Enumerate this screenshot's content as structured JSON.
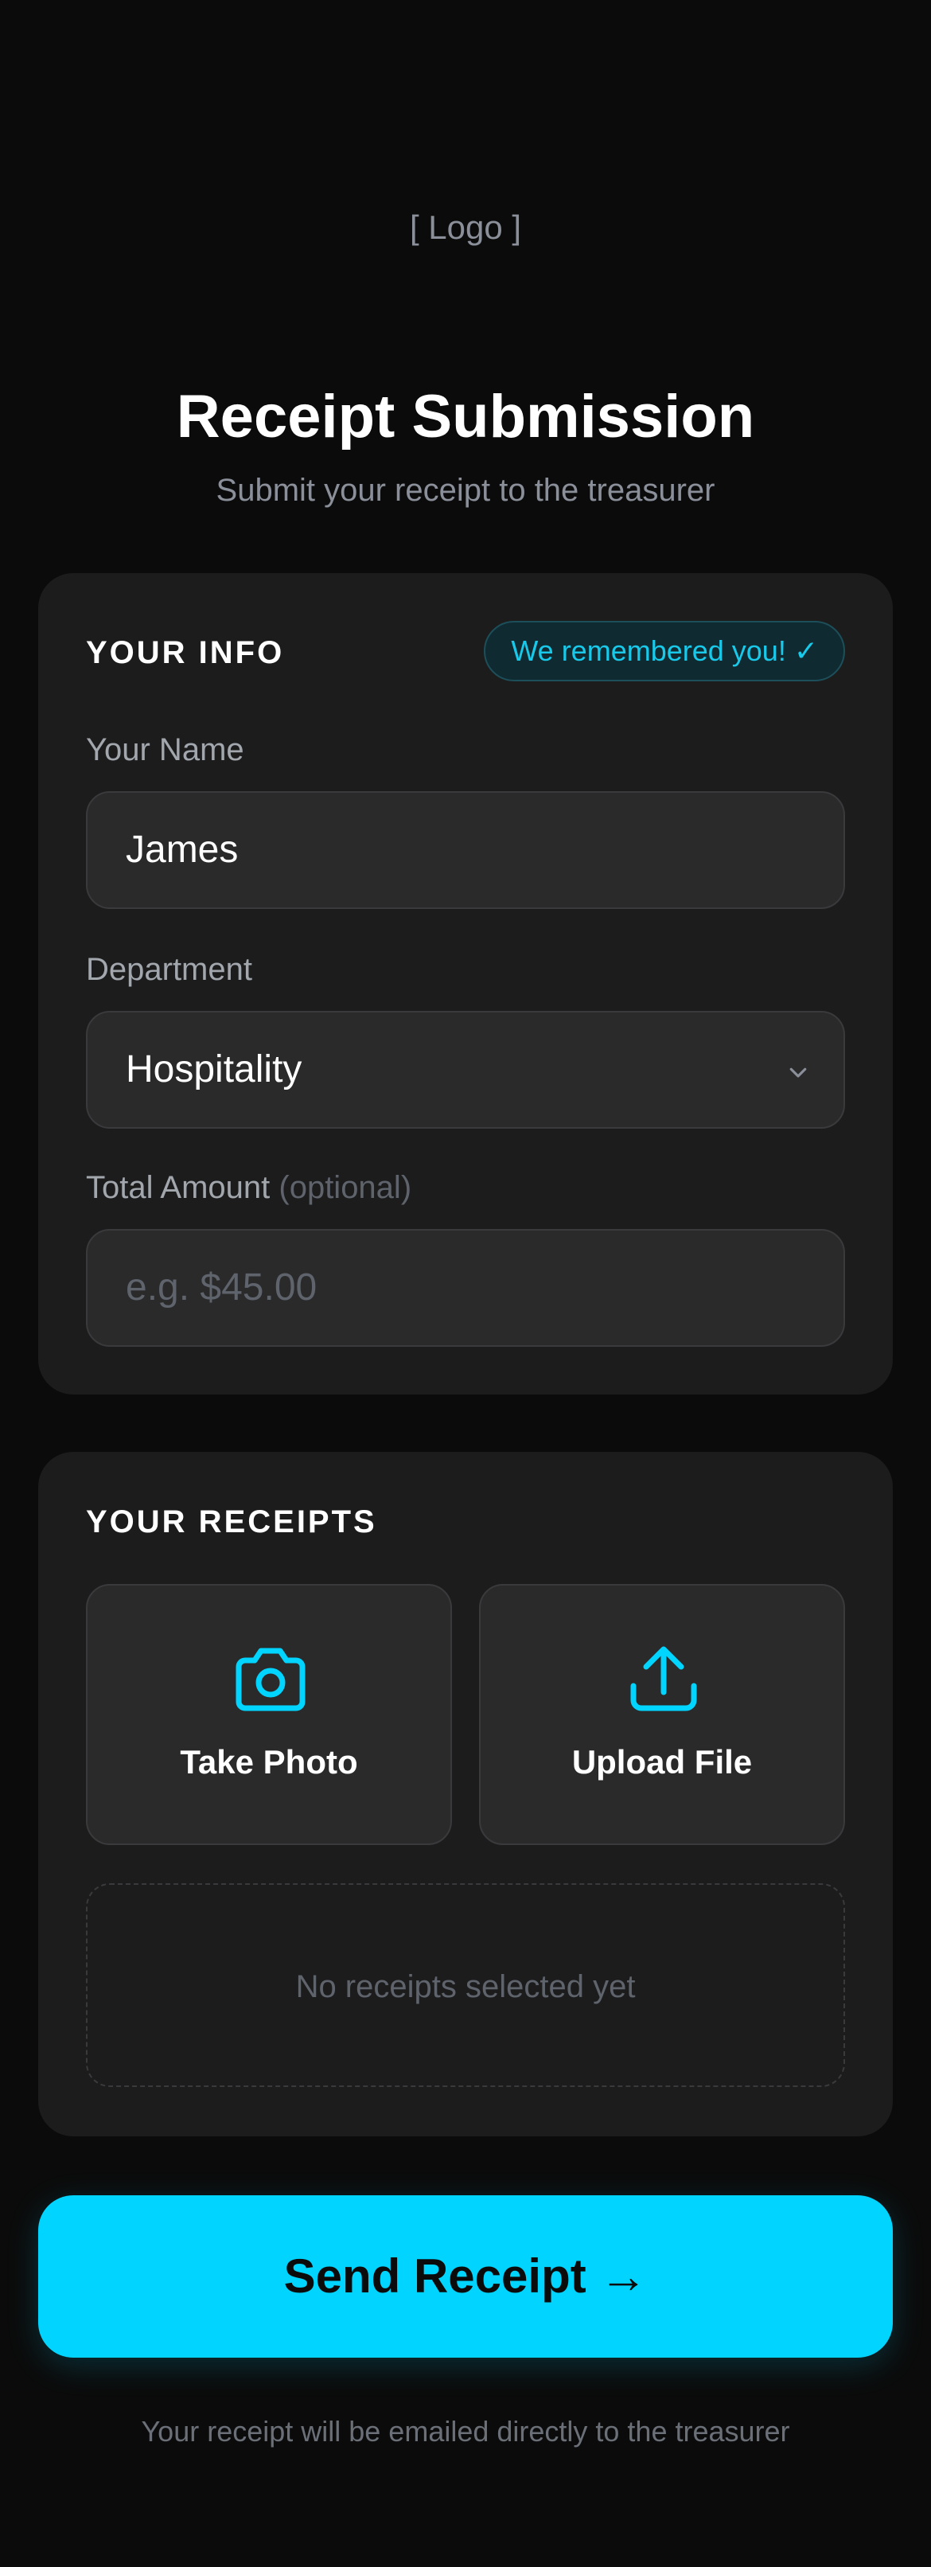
{
  "logo": {
    "text": "[ Logo ]"
  },
  "header": {
    "title": "Receipt Submission",
    "subtitle": "Submit your receipt to the treasurer"
  },
  "info": {
    "section_title": "YOUR INFO",
    "badge": "We remembered you! ✓",
    "name": {
      "label": "Your Name",
      "value": "James"
    },
    "department": {
      "label": "Department",
      "value": "Hospitality"
    },
    "amount": {
      "label": "Total Amount",
      "optional": "(optional)",
      "placeholder": "e.g. $45.00"
    }
  },
  "receipts": {
    "section_title": "YOUR RECEIPTS",
    "take_photo": {
      "label": "Take Photo",
      "icon": "camera-icon"
    },
    "upload_file": {
      "label": "Upload File",
      "icon": "upload-icon"
    },
    "empty_text": "No receipts selected yet"
  },
  "submit": {
    "label": "Send Receipt →"
  },
  "footer": {
    "note": "Your receipt will be emailed directly to the treasurer"
  },
  "colors": {
    "accent": "#00d4ff",
    "background": "#0b0b0b",
    "card": "#1c1c1d",
    "field": "#2a2a2b"
  }
}
